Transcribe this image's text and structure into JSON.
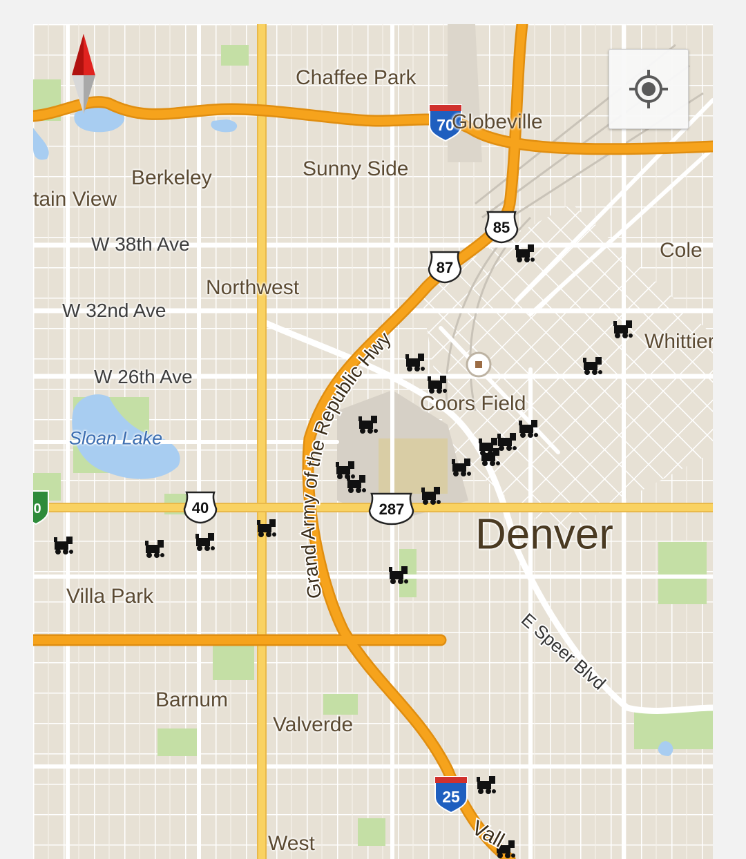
{
  "map": {
    "city": "Denver",
    "neighborhoods": [
      "Chaffee Park",
      "Globeville",
      "Sunny Side",
      "Berkeley",
      "tain View",
      "Cole",
      "Northwest",
      "Whittier",
      "Coors Field",
      "Villa Park",
      "Barnum",
      "Valverde",
      "West"
    ],
    "streets": [
      "W 38th Ave",
      "W 32nd Ave",
      "W 26th Ave"
    ],
    "curved_labels": [
      "Grand Army of the Republic Hwy",
      "E Speer Blvd",
      "Vall"
    ],
    "water": [
      "Sloan Lake"
    ],
    "shields": {
      "interstate_70": "70",
      "interstate_25": "25",
      "us_85": "85",
      "us_87": "87",
      "us_40": "40",
      "us_287": "287",
      "partial_left": "0"
    },
    "stadium_marker": "stadium-icon",
    "rail_marker": "train-icon",
    "rail_marker_count": 21,
    "controls": {
      "locate": "my-location-icon",
      "compass": "compass-icon"
    },
    "colors": {
      "land": "#e7e1d5",
      "highway": "#f6a31c",
      "arterial": "#f9d262",
      "local_street": "#ffffff",
      "water": "#a8cdf1",
      "park": "#c4dfa5"
    }
  }
}
